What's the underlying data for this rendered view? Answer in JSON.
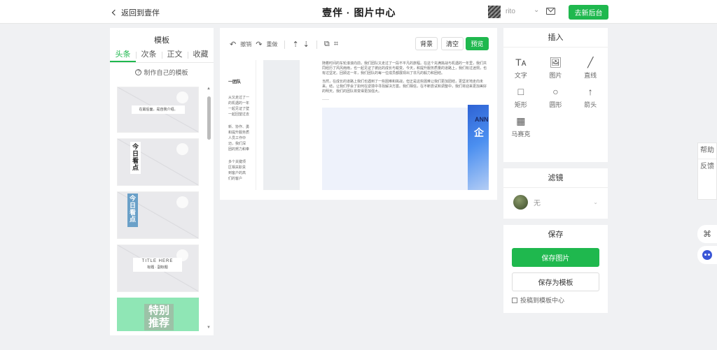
{
  "header": {
    "back_label": "返回到壹伴",
    "brand": "壹伴 · 图片中心",
    "username": "rito",
    "go_button": "去新后台"
  },
  "left_panel": {
    "title": "模板",
    "tabs": [
      "头条",
      "次条",
      "正文",
      "收藏"
    ],
    "make_own": "制作自己的模板",
    "templates": [
      {
        "text": "在最后面，是自我介绍。"
      },
      {
        "text": "今日看点"
      },
      {
        "text": "今日看点"
      },
      {
        "text": "TITLE HERE",
        "subtext": "标题 · 副标题"
      },
      {
        "text": "特别推荐"
      }
    ]
  },
  "toolbar": {
    "undo": "撤销",
    "redo": "重做",
    "background": "背景",
    "clear": "清空",
    "preview": "预览"
  },
  "canvas": {
    "left_snippet": [
      "一团队",
      "从又走过了一",
      "的机遇的一年",
      "一起见证了壁",
      "一起回望过去",
      "新、协作、勇",
      "和提升服务质",
      "人员工作中",
      "迈，我们深",
      "团的努力和奉",
      "多个关键项",
      "区相关职责",
      "到客户的高",
      "们的客户"
    ],
    "paragraph1": "随着时间的车轮滚滚向前，我们团队又走过了一段不平凡的旅程。在这个充满挑战与机遇的一年里，我们共同经历了风风雨雨，也一起见证了彼此的成长与蜕变。今天，和提升服务质量的道路上，我们有过迷惘，也有过坚定。回顾这一年，我们团队的每一位成员都展现出了非凡的毅力和团结。",
    "paragraph2": "当然，在成长的道路上我们也遇到了一些困难和挑战，但正是这些困难让我们更加团结，更坚定地走向未来。结，让我们学会了如何在逆境中寻找解决方案。我们相信，在不断尝试和调整中，我们将迎来更加美好的明天。我们的团队将变得更加强大。",
    "divider_text": "——",
    "banner_text": "ANN",
    "banner_big": "企"
  },
  "insert_panel": {
    "title": "插入",
    "items": [
      {
        "label": "文字",
        "icon": "text-icon"
      },
      {
        "label": "图片",
        "icon": "image-icon"
      },
      {
        "label": "直线",
        "icon": "line-icon"
      },
      {
        "label": "矩形",
        "icon": "rectangle-icon"
      },
      {
        "label": "圆形",
        "icon": "circle-icon"
      },
      {
        "label": "箭头",
        "icon": "arrow-icon"
      },
      {
        "label": "马赛克",
        "icon": "mosaic-icon"
      }
    ]
  },
  "filter_panel": {
    "title": "滤镜",
    "value": "无"
  },
  "save_panel": {
    "title": "保存",
    "save_image": "保存图片",
    "save_template": "保存为模板",
    "contribute": "投稿到模板中心"
  },
  "float": {
    "help": "帮助",
    "feedback": "反馈"
  },
  "colors": {
    "accent": "#1fb84e",
    "page_bg": "#f0f1f3"
  }
}
